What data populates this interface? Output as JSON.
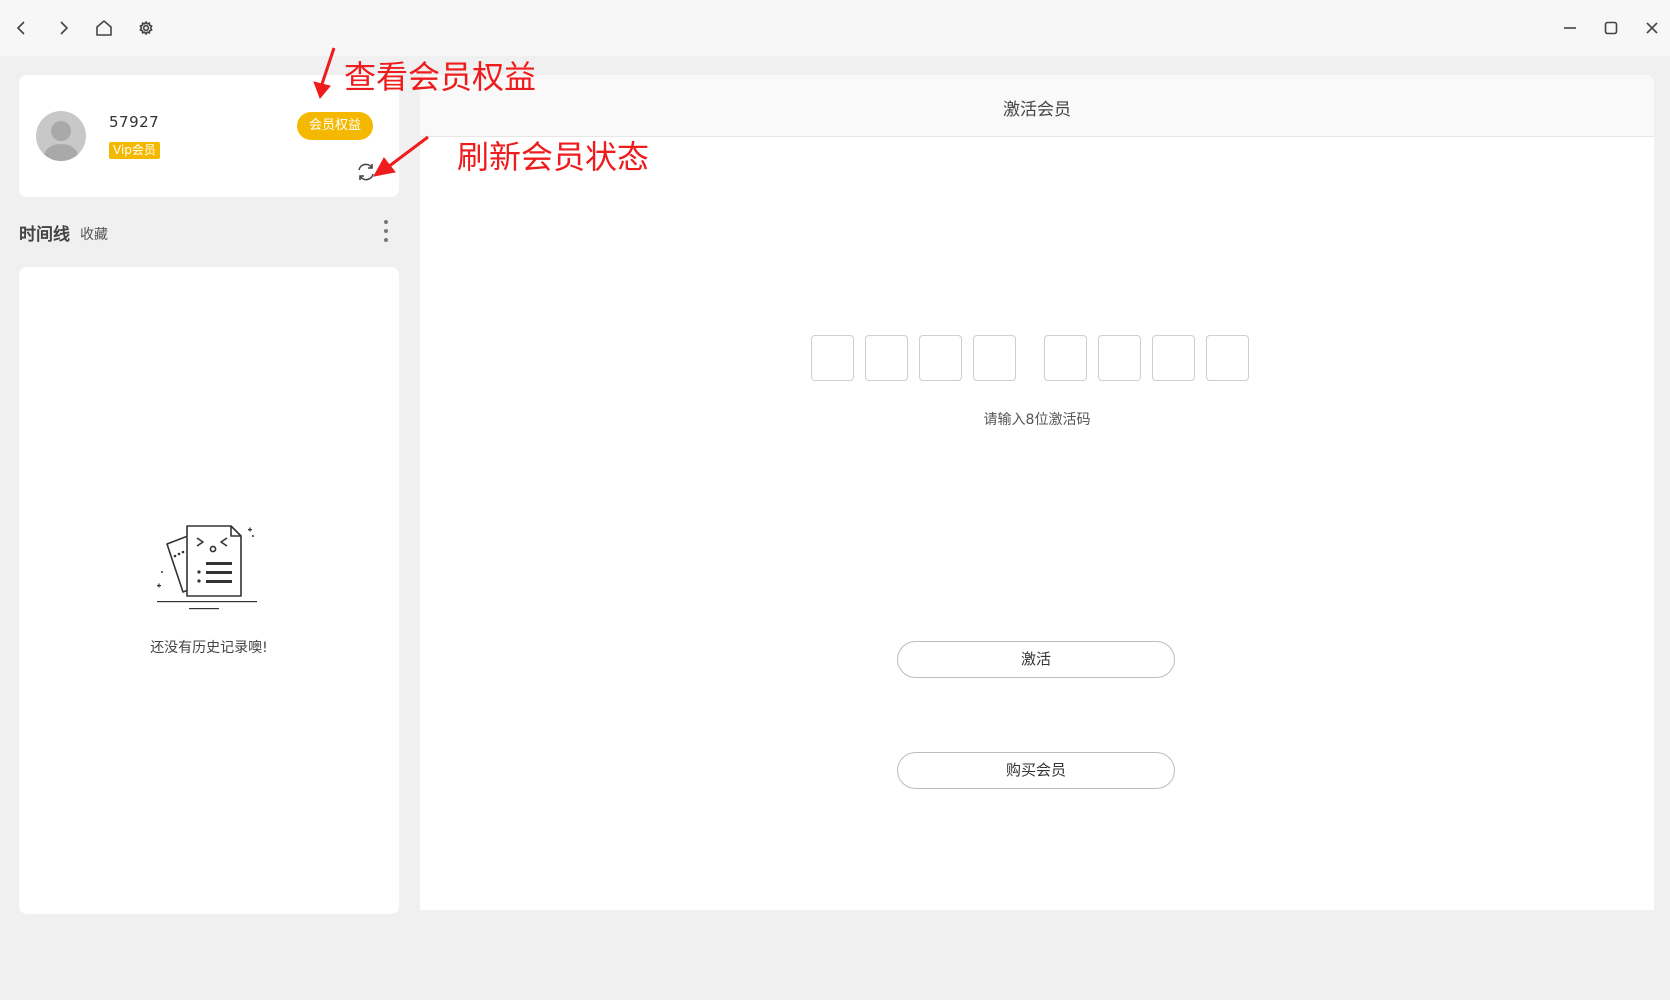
{
  "titlebar": {
    "left_buttons": [
      "back-icon",
      "forward-icon",
      "home-icon",
      "settings-icon"
    ],
    "right_buttons": [
      "minimize-icon",
      "maximize-icon",
      "close-icon"
    ]
  },
  "user": {
    "id": "57927",
    "vip_label": "Vip会员",
    "benefits_button": "会员权益"
  },
  "timeline": {
    "title": "时间线",
    "favorites": "收藏",
    "empty_text": "还没有历史记录噢!"
  },
  "activation": {
    "header": "激活会员",
    "code_length": 8,
    "hint": "请输入8位激活码",
    "activate_button": "激活",
    "buy_button": "购买会员"
  },
  "annotations": {
    "view_benefits": "查看会员权益",
    "refresh_status": "刷新会员状态"
  },
  "colors": {
    "vip_accent": "#f5b800",
    "annotation_red": "#ee1c1c"
  }
}
